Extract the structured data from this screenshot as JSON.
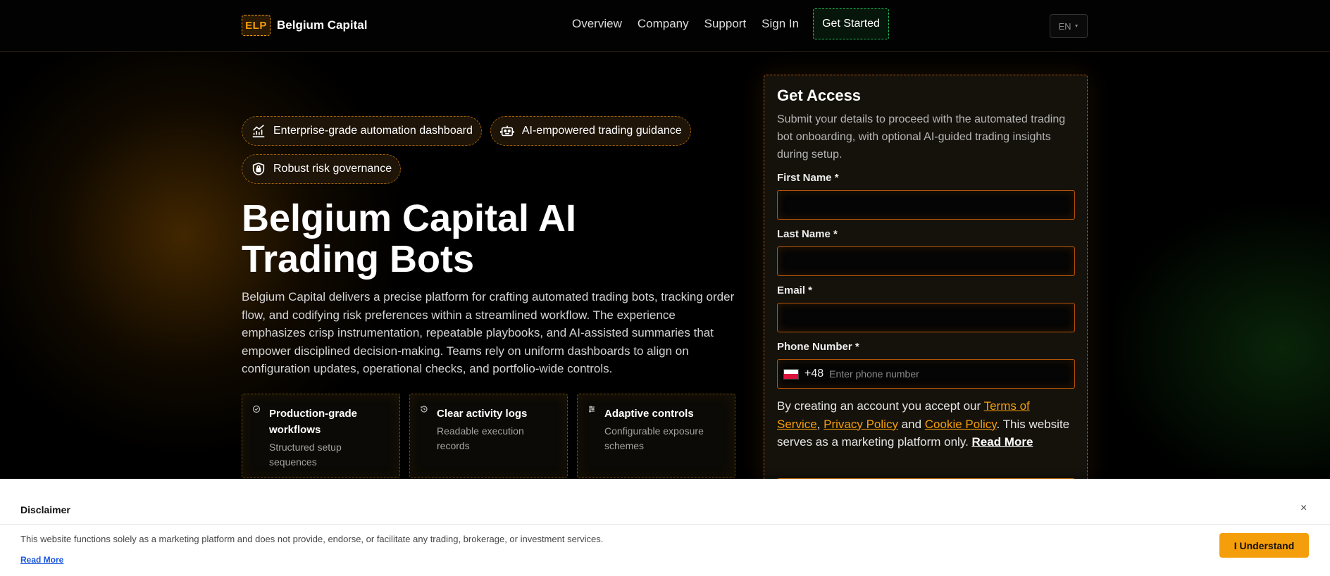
{
  "brand": {
    "logo_mark": "ELP",
    "name": "Belgium Capital"
  },
  "nav": {
    "links": [
      "Overview",
      "Company",
      "Support",
      "Sign In"
    ],
    "cta": "Get Started",
    "language": "EN"
  },
  "hero": {
    "chips": [
      {
        "icon": "chart-icon",
        "label": "Enterprise-grade automation dashboard"
      },
      {
        "icon": "robot-icon",
        "label": "AI-empowered trading guidance"
      },
      {
        "icon": "shield-lock-icon",
        "label": "Robust risk governance"
      }
    ],
    "title_line1": "Belgium Capital AI",
    "title_line2": "Trading Bots",
    "description": "Belgium Capital delivers a precise platform for crafting automated trading bots, tracking order flow, and codifying risk preferences within a streamlined workflow. The experience emphasizes crisp instrumentation, repeatable playbooks, and AI-assisted summaries that empower disciplined decision-making. Teams rely on uniform dashboards to align on configuration updates, operational checks, and portfolio-wide controls.",
    "features": [
      {
        "icon": "check-circle-icon",
        "title": "Production-grade workflows",
        "text": "Structured setup sequences"
      },
      {
        "icon": "history-icon",
        "title": "Clear activity logs",
        "text": "Readable execution records"
      },
      {
        "icon": "sliders-icon",
        "title": "Adaptive controls",
        "text": "Configurable exposure schemes"
      }
    ]
  },
  "form": {
    "title": "Get Access",
    "subtitle": "Submit your details to proceed with the automated trading bot onboarding, with optional AI-guided trading insights during setup.",
    "first_name_label": "First Name *",
    "last_name_label": "Last Name *",
    "email_label": "Email *",
    "phone_label": "Phone Number *",
    "phone_code": "+48",
    "phone_placeholder": "Enter phone number",
    "terms_prefix": "By creating an account you accept our ",
    "terms_link": "Terms of Service",
    "comma": ", ",
    "privacy_link": "Privacy Policy",
    "and": " and ",
    "cookie_link": "Cookie Policy",
    "terms_suffix": ". This website serves as a marketing platform only. ",
    "read_more": "Read More"
  },
  "disclaimer": {
    "title": "Disclaimer",
    "close": "×",
    "text": "This website functions solely as a marketing platform and does not provide, endorse, or facilitate any trading, brokerage, or investment services.",
    "read_more": "Read More",
    "accept": "I Understand"
  },
  "colors": {
    "accent": "#f59e0b",
    "green": "#22c55e",
    "background": "#000000"
  }
}
